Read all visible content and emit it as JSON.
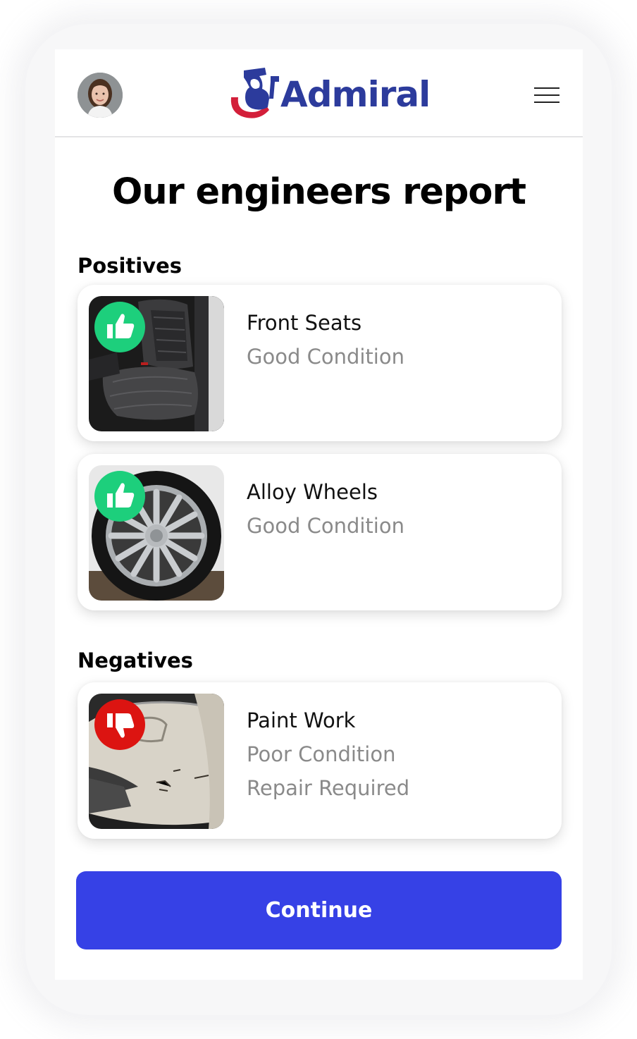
{
  "header": {
    "avatar": "user-avatar",
    "logo_text": "Admiral",
    "menu_icon": "hamburger-menu-icon"
  },
  "page": {
    "title": "Our engineers report"
  },
  "positives": {
    "label": "Positives",
    "items": [
      {
        "title": "Front Seats",
        "line1": "Good Condition",
        "badge_icon": "thumbs-up-icon",
        "image": "front-seats-photo"
      },
      {
        "title": "Alloy Wheels",
        "line1": "Good Condition",
        "badge_icon": "thumbs-up-icon",
        "image": "alloy-wheel-photo"
      }
    ]
  },
  "negatives": {
    "label": "Negatives",
    "items": [
      {
        "title": "Paint Work",
        "line1": "Poor Condition",
        "line2": "Repair Required",
        "badge_icon": "thumbs-down-icon",
        "image": "damaged-bumper-photo"
      }
    ]
  },
  "actions": {
    "continue_label": "Continue"
  },
  "colors": {
    "accent": "#3641e6",
    "positive": "#1dcf7c",
    "negative": "#dc1411",
    "brand_blue": "#2c3b9c",
    "brand_red": "#d31f3a"
  }
}
